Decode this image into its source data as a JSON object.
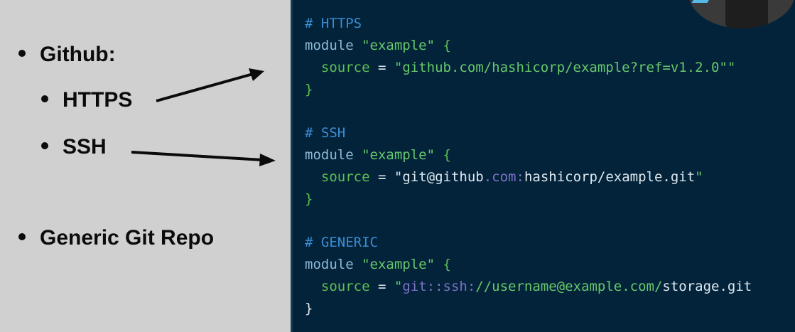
{
  "bullets": {
    "github": "Github:",
    "https": "HTTPS",
    "ssh": "SSH",
    "generic": "Generic Git Repo"
  },
  "code": {
    "https": {
      "comment": "# HTTPS",
      "module_kw": "module",
      "module_name": "\"example\"",
      "open_brace": "{",
      "source_kw": "source",
      "equals": "=",
      "source_value": "\"github.com/hashicorp/example?ref=v1.2.0\"\"",
      "close_brace": "}"
    },
    "ssh": {
      "comment": "# SSH",
      "module_kw": "module",
      "module_name": "\"example\"",
      "open_brace": "{",
      "source_kw": "source",
      "equals": "=",
      "source_part1": "\"git@github",
      "source_part2": ".com:",
      "source_part3": "hashicorp/example",
      "source_part4": ".git",
      "source_part5": "\"",
      "close_brace": "}"
    },
    "generic": {
      "comment": "# GENERIC",
      "module_kw": "module",
      "module_name": "\"example\"",
      "open_brace": "{",
      "source_kw": "source",
      "equals": "=",
      "source_part1": "\"",
      "source_part2": "git::ssh:",
      "source_part3": "//username@example.com/",
      "source_part4": "storage",
      "source_part5": ".git",
      "close_brace": "}"
    }
  },
  "colors": {
    "left_background": "#d0d0d0",
    "code_background": "#02233a",
    "comment": "#3b8ed4",
    "string": "#68c86b",
    "purple": "#7d72c9"
  }
}
